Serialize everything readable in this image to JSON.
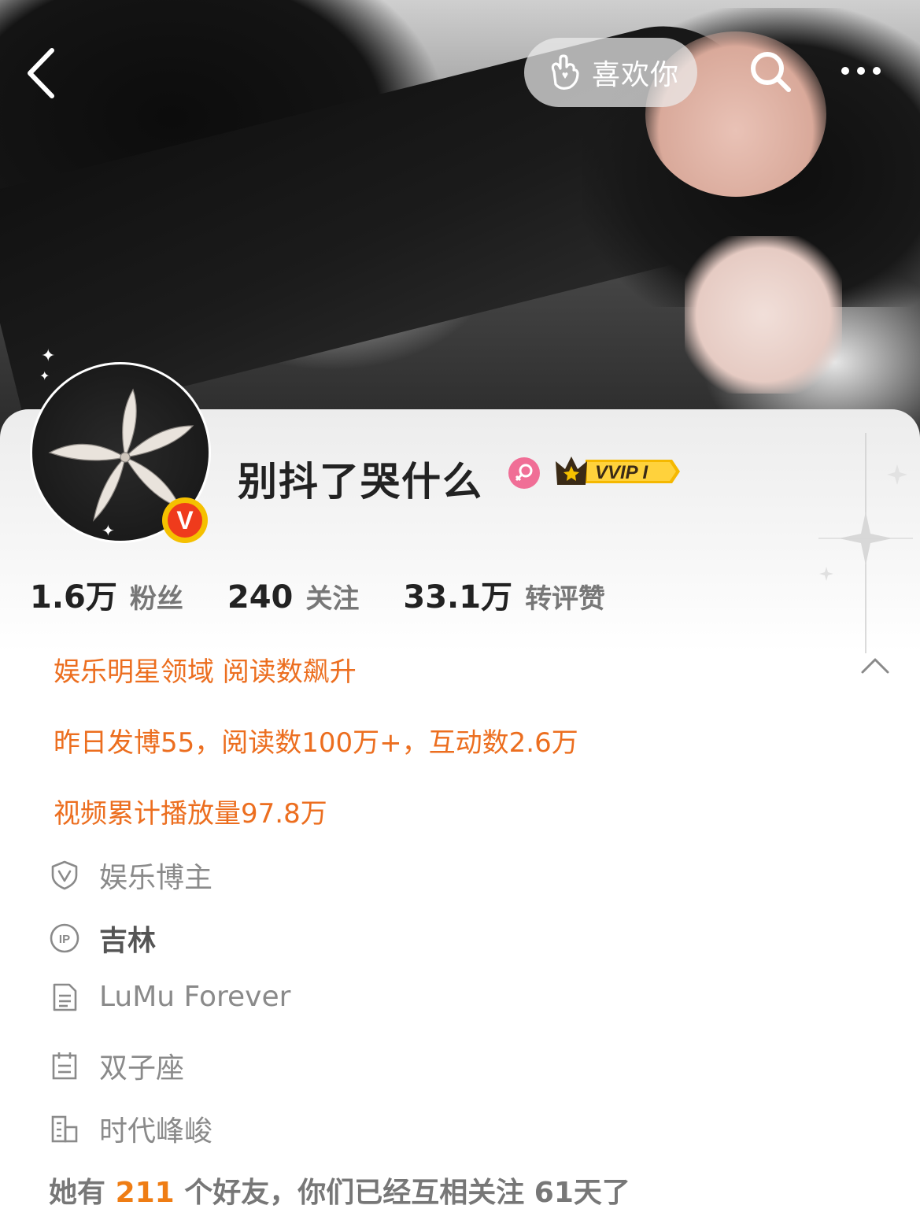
{
  "nav": {
    "like_label": "喜欢你"
  },
  "profile": {
    "nickname": "别抖了哭什么",
    "verified_badge": "V",
    "vip_badge": "VVIP I"
  },
  "stats": [
    {
      "value": "1.6万",
      "label": "粉丝"
    },
    {
      "value": "240",
      "label": "关注"
    },
    {
      "value": "33.1万",
      "label": "转评赞"
    }
  ],
  "highlights": {
    "domain": "娱乐明星领域 阅读数飙升",
    "yesterday": "昨日发博55，阅读数100万+，互动数2.6万",
    "video": "视频累计播放量97.8万"
  },
  "details": {
    "verification": "娱乐博主",
    "ip": "吉林",
    "bio": "LuMu Forever",
    "zodiac": "双子座",
    "company": "时代峰峻"
  },
  "friends": {
    "prefix": "她有",
    "count": "211",
    "suffix": "个好友，你们已经互相关注 61天了"
  },
  "icons": {
    "back": "chevron-left-icon",
    "like": "hand-heart-icon",
    "search": "search-icon",
    "more": "more-dots-icon",
    "gender": "female-icon",
    "expand": "chevron-up-icon",
    "verification": "shield-v-icon",
    "ip": "ip-icon",
    "bio": "document-icon",
    "zodiac": "calendar-icon",
    "company": "building-icon"
  },
  "colors": {
    "accent_orange": "#ec6e1f",
    "friend_count": "#ef7d14",
    "vip_gold": "#f5b800"
  }
}
